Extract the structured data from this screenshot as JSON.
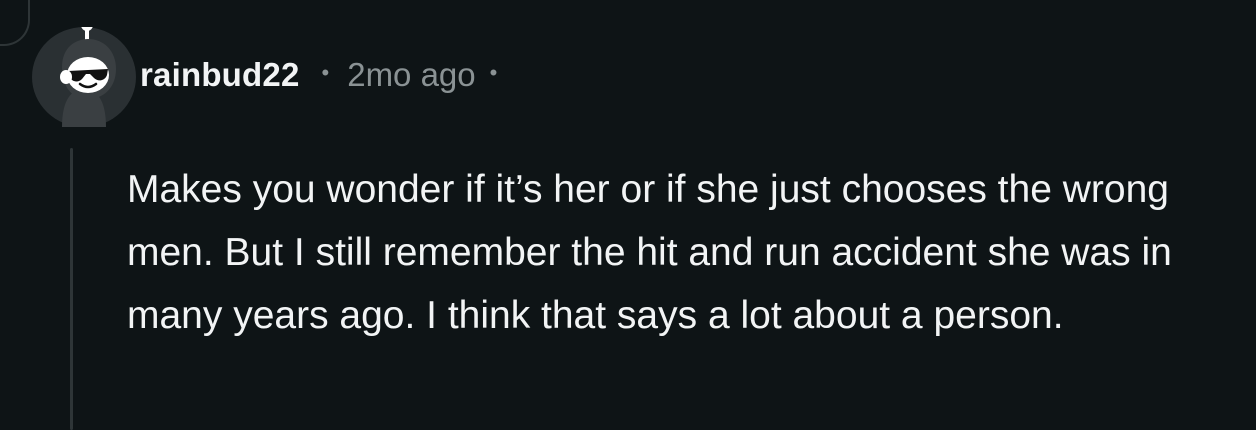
{
  "comment": {
    "username": "rainbud22",
    "separator": "•",
    "timestamp": "2mo ago",
    "trailing_separator": "•",
    "avatar_icon": "snoo-avatar-with-sunglasses-icon",
    "body": "Makes you wonder if it’s her or if she just chooses the wrong men. But I still remember the hit and run accident she was in many years ago. I think that says a lot about a person."
  },
  "colors": {
    "background": "#0e1416",
    "text_primary": "#f2f4f5",
    "text_secondary": "#8a9294",
    "thread_line": "#2e3537",
    "avatar_bg": "#2a3033"
  }
}
